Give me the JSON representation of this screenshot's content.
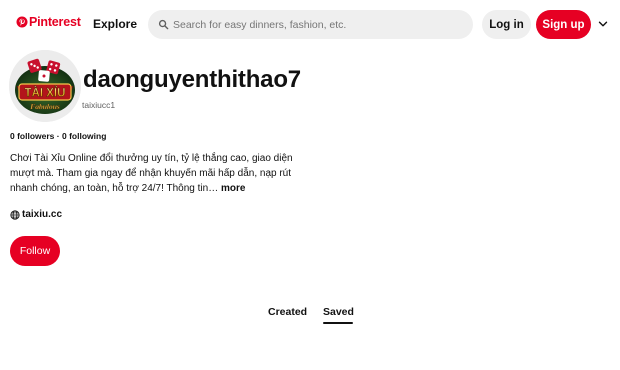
{
  "header": {
    "logo_text": "Pinterest",
    "logo_icon": "pinterest-logo-icon",
    "explore_label": "Explore",
    "search": {
      "placeholder": "Search for easy dinners, fashion, etc.",
      "value": "",
      "icon": "search-icon"
    },
    "login_label": "Log in",
    "signup_label": "Sign up",
    "menu_icon": "chevron-down-icon"
  },
  "profile": {
    "avatar_text_main": "TÀI XỈU",
    "avatar_text_sub": "Fabulous",
    "display_name": "daonguyenthithao7",
    "username": "taixiucc1",
    "followers_label": "0 followers",
    "separator": "·",
    "following_label": "0 following",
    "bio": "Chơi Tài Xỉu Online đổi thưởng uy tín, tỷ lệ thắng cao, giao diện mượt mà. Tham gia ngay để nhận khuyến mãi hấp dẫn, nạp rút nhanh chóng, an toàn, hỗ trợ 24/7! Thông tin…",
    "bio_more": "more",
    "website": "taixiu.cc",
    "website_icon": "globe-icon",
    "follow_label": "Follow"
  },
  "tabs": {
    "created": "Created",
    "saved": "Saved",
    "active": "saved"
  },
  "colors": {
    "brand": "#e60023",
    "button_gray": "#efefef",
    "text": "#111111",
    "muted": "#5f5f5f"
  }
}
